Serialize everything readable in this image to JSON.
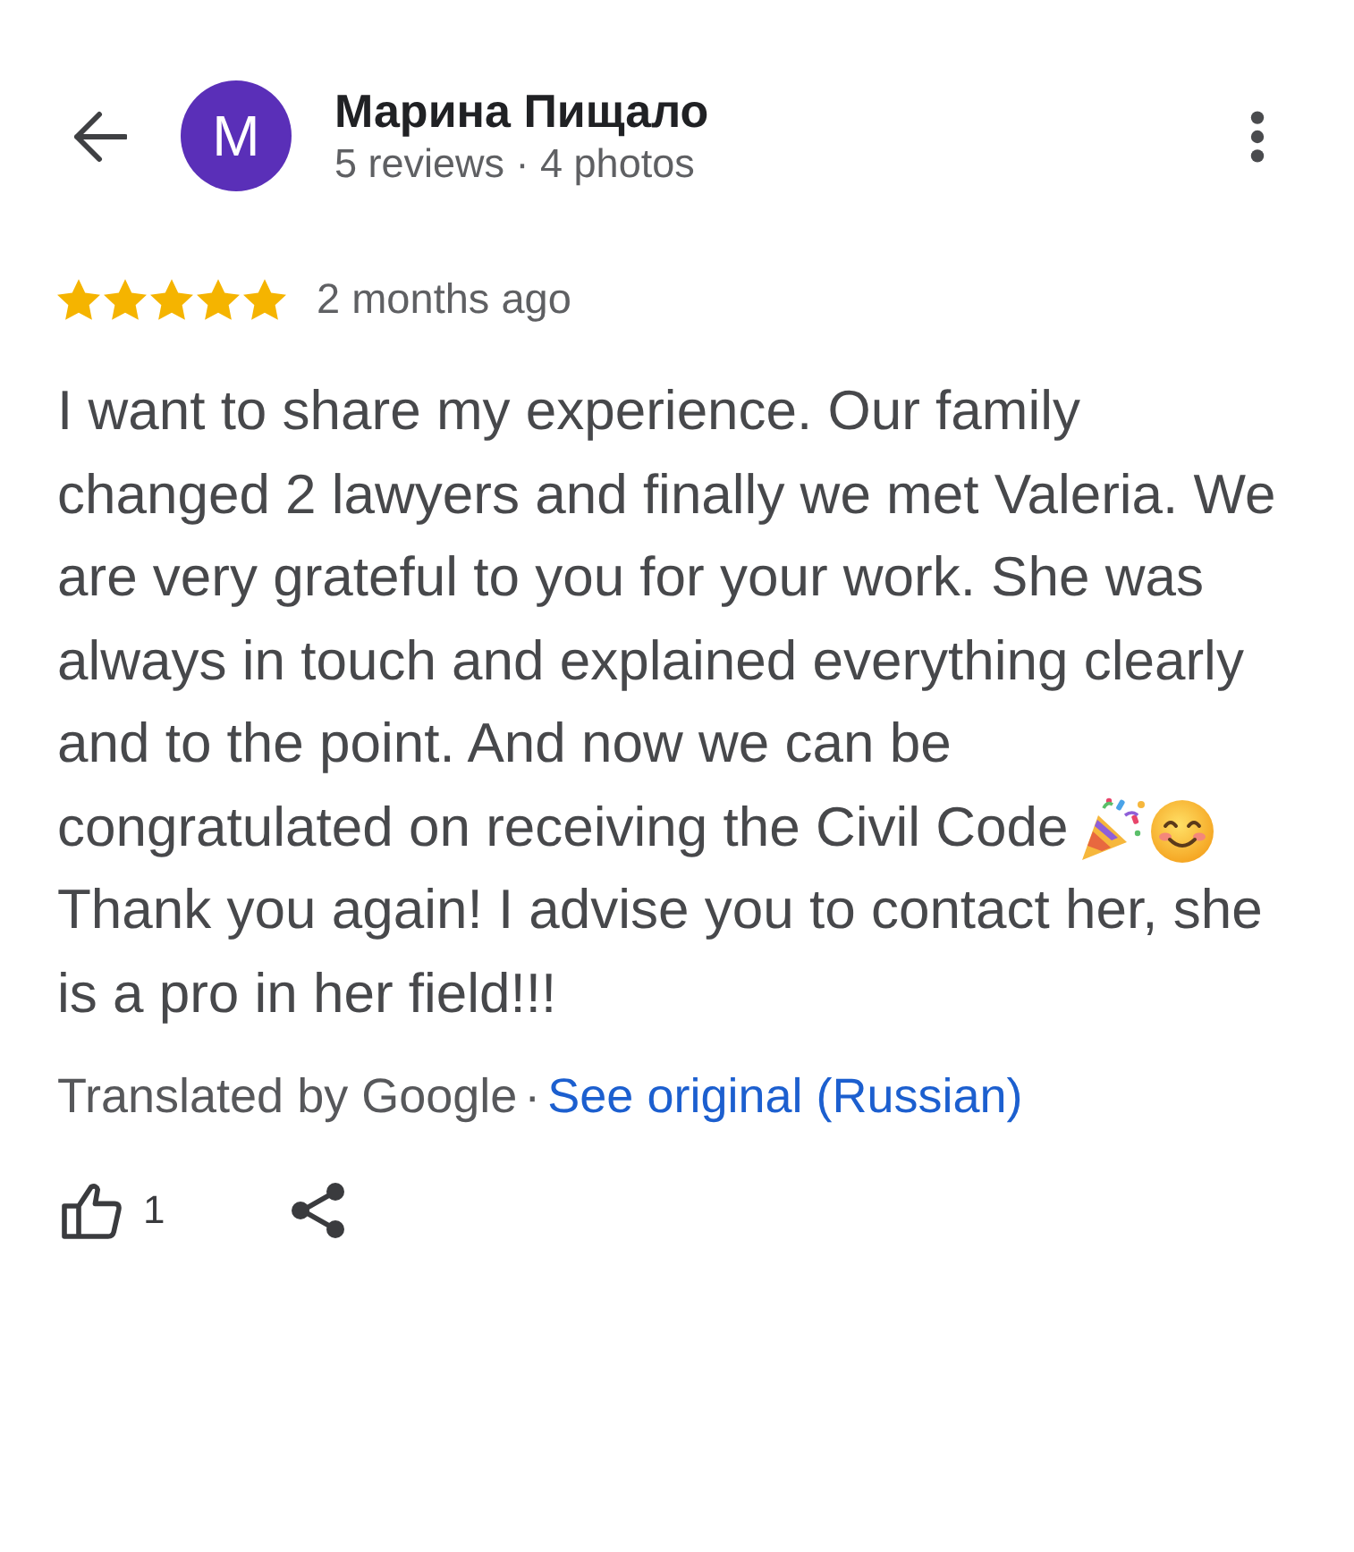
{
  "reviewer": {
    "initial": "M",
    "name": "Марина Пищало",
    "stats": "5 reviews · 4 photos"
  },
  "rating": {
    "stars": 5,
    "time": "2 months ago"
  },
  "review": {
    "text": "I want to share my experience. Our family\nchanged 2 lawyers and finally we met Valeria. We\nare very grateful to you for your work. She was\nalways in touch and explained everything clearly\nand to the point. And now we can be",
    "emoji_line": "congratulated on receiving the Civil Code",
    "closing": "Thank you again! I advise you to contact her, she\nis a pro in her field!!!"
  },
  "translation": {
    "note": "Translated by Google",
    "separator": "·",
    "link": "See original (Russian)"
  },
  "actions": {
    "likes": "1"
  }
}
